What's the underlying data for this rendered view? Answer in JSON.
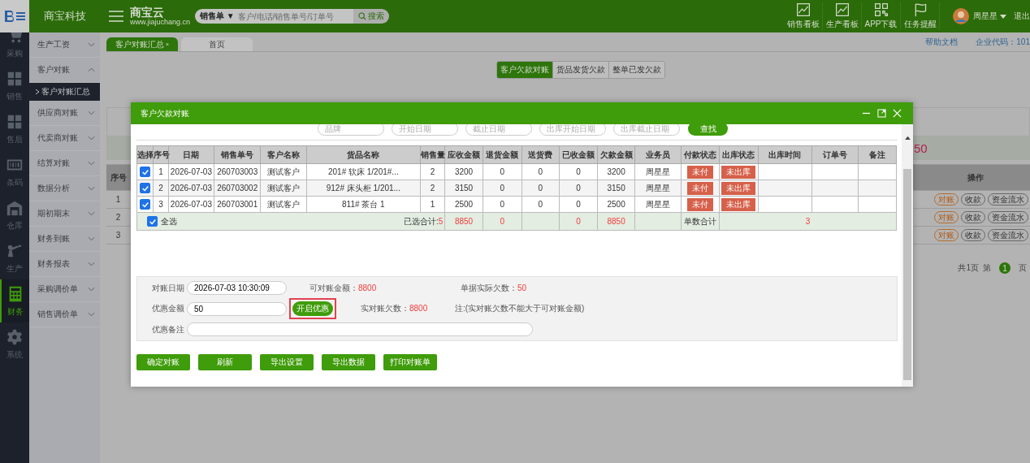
{
  "topbar": {
    "company": "商宝科技",
    "brand": "商宝云",
    "brand_url": "www.jiajuchang.cn",
    "search": {
      "type_label": "销售单 ▼",
      "placeholder": "客户/电话/销售单号/订单号",
      "button": "搜索"
    },
    "nav": [
      {
        "label": "销售看板"
      },
      {
        "label": "生产看板"
      },
      {
        "label": "APP下载"
      },
      {
        "label": "任务提醒"
      }
    ],
    "user": {
      "name": "周星星",
      "logout": "退出"
    }
  },
  "rail": [
    {
      "label": "采购",
      "selected": false
    },
    {
      "label": "销售",
      "selected": false
    },
    {
      "label": "售后",
      "selected": false
    },
    {
      "label": "条码",
      "selected": false
    },
    {
      "label": "仓库",
      "selected": false
    },
    {
      "label": "生产",
      "selected": false
    },
    {
      "label": "财务",
      "selected": true
    },
    {
      "label": "系统",
      "selected": false
    }
  ],
  "sidebar": {
    "items": [
      {
        "label": "生产工资",
        "expanded": false
      },
      {
        "label": "客户对账",
        "expanded": true,
        "children": [
          {
            "label": "客户对账汇总",
            "selected": true
          }
        ]
      },
      {
        "label": "供应商对账",
        "expanded": false
      },
      {
        "label": "代卖商对账",
        "expanded": false
      },
      {
        "label": "结算对账",
        "expanded": false
      },
      {
        "label": "数据分析",
        "expanded": false
      },
      {
        "label": "期初期末",
        "expanded": false
      },
      {
        "label": "财务到账",
        "expanded": false
      },
      {
        "label": "财务报表",
        "expanded": false
      },
      {
        "label": "采购调价单",
        "expanded": false
      },
      {
        "label": "销售调价单",
        "expanded": false
      }
    ]
  },
  "tabs": [
    {
      "label": "客户对账汇总",
      "selected": true,
      "close": "×"
    },
    {
      "label": "首页",
      "selected": false
    }
  ],
  "header_links": [
    "帮助文档",
    "企业代码：101"
  ],
  "segments": [
    {
      "label": "客户欠款对账",
      "selected": true
    },
    {
      "label": "货品发货欠款",
      "selected": false
    },
    {
      "label": "整单已发欠款",
      "selected": false
    }
  ],
  "summary_value": "50",
  "background_table": {
    "columns": [
      "序号",
      "操作"
    ],
    "rows": [
      {
        "no": "1",
        "actions": [
          {
            "label": "对账",
            "kind": "primary"
          },
          {
            "label": "收款",
            "kind": "plain"
          },
          {
            "label": "资金流水",
            "kind": "plain"
          }
        ]
      },
      {
        "no": "2",
        "actions": [
          {
            "label": "对账",
            "kind": "primary"
          },
          {
            "label": "收款",
            "kind": "plain"
          },
          {
            "label": "资金流水",
            "kind": "plain"
          }
        ]
      },
      {
        "no": "3",
        "actions": [
          {
            "label": "对账",
            "kind": "primary"
          },
          {
            "label": "收款",
            "kind": "plain"
          },
          {
            "label": "资金流水",
            "kind": "plain"
          }
        ]
      }
    ]
  },
  "pagination": {
    "total": "共1页",
    "page_prefix": "第",
    "page": "1",
    "page_suffix": "页"
  },
  "modal": {
    "title": "客户欠款对账",
    "filters": [
      {
        "placeholder": "品牌"
      },
      {
        "placeholder": "开始日期"
      },
      {
        "placeholder": "截止日期"
      },
      {
        "placeholder": "出库开始日期"
      },
      {
        "placeholder": "出库截止日期"
      }
    ],
    "search_button": "查找",
    "table": {
      "columns": [
        "选择",
        "序号",
        "日期",
        "销售单号",
        "客户名称",
        "货品名称",
        "销售量",
        "应收金额",
        "退货金额",
        "送货费",
        "已收金额",
        "欠款金额",
        "业务员",
        "付款状态",
        "出库状态",
        "出库时间",
        "订单号",
        "备注"
      ],
      "rows": [
        {
          "checked": true,
          "no": "1",
          "date": "2026-07-03",
          "order_no": "260703003",
          "customer": "测试客户",
          "goods": "201# 软床 1/201#...",
          "qty": "2",
          "receivable": "3200",
          "returned": "0",
          "delivery_fee": "0",
          "received": "0",
          "owed": "3200",
          "salesman": "周星星",
          "pay_status": "未付",
          "ship_status": "未出库"
        },
        {
          "checked": true,
          "no": "2",
          "date": "2026-07-03",
          "order_no": "260703002",
          "customer": "测试客户",
          "goods": "912# 床头柜 1/201...",
          "qty": "2",
          "receivable": "3150",
          "returned": "0",
          "delivery_fee": "0",
          "received": "0",
          "owed": "3150",
          "salesman": "周星星",
          "pay_status": "未付",
          "ship_status": "未出库"
        },
        {
          "checked": true,
          "no": "3",
          "date": "2026-07-03",
          "order_no": "260703001",
          "customer": "测试客户",
          "goods": "811# 茶台 1",
          "qty": "1",
          "receivable": "2500",
          "returned": "0",
          "delivery_fee": "0",
          "received": "0",
          "owed": "2500",
          "salesman": "周星星",
          "pay_status": "未付",
          "ship_status": "未出库"
        }
      ],
      "footer": {
        "select_all": {
          "label": "全选",
          "checked": true
        },
        "selected_label": "已选合计:",
        "selected_count": "5",
        "receivable": "8850",
        "returned": "0",
        "received": "0",
        "owed": "8850",
        "count_label": "单数合计",
        "count": "3"
      }
    },
    "form": {
      "date_label": "对账日期",
      "date_value": "2026-07-03 10:30:09",
      "available_label": "可对账金额：",
      "available_value": "8800",
      "actual_label": "单据实际欠数：",
      "actual_value": "50",
      "discount_label": "优惠金额",
      "discount_value": "50",
      "discount_button": {
        "label": "开启优惠",
        "highlighted": true
      },
      "real_label": "实对账欠数：",
      "real_value": "8800",
      "note": "注:(实对账欠数不能大于可对账金额)",
      "remark_label": "优惠备注"
    },
    "buttons": [
      "确定对账",
      "刷新",
      "导出设置",
      "导出数据",
      "打印对账单"
    ]
  }
}
